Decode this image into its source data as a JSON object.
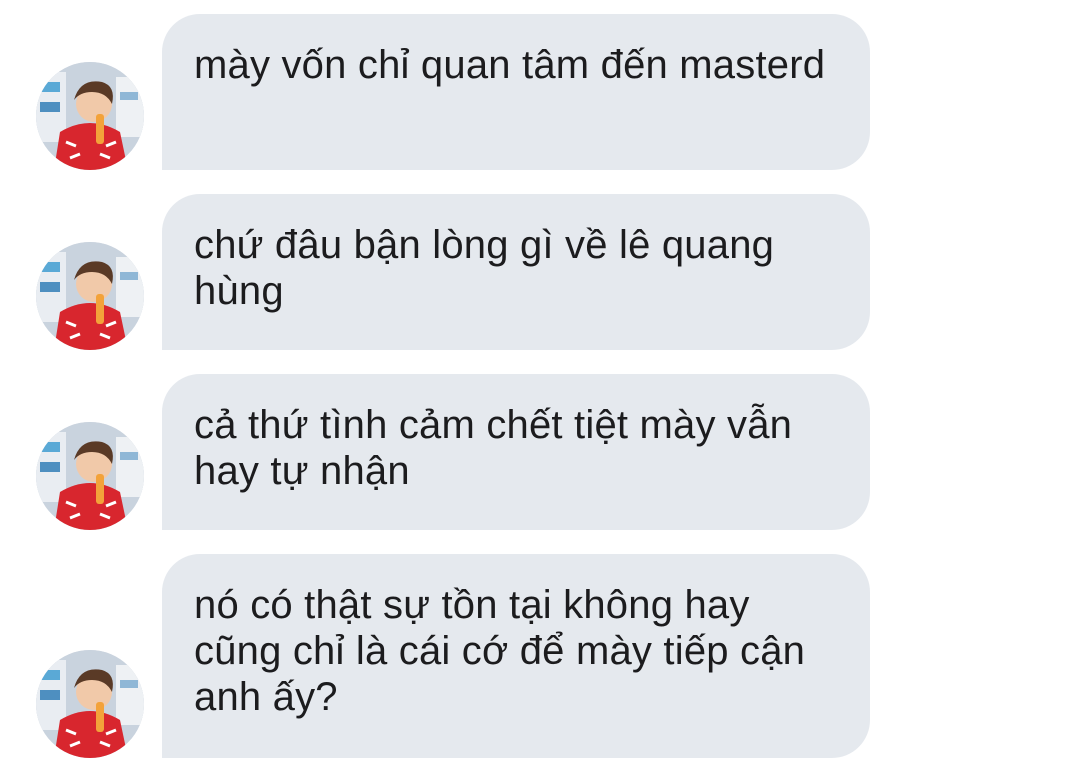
{
  "conversation": {
    "messages": [
      {
        "text": "mày vốn chỉ quan tâm đến masterd"
      },
      {
        "text": "chứ đâu bận lòng gì về lê quang hùng"
      },
      {
        "text": "cả thứ tình cảm chết tiệt mày vẫn hay tự nhận"
      },
      {
        "text": "nó có thật sự tồn tại không hay cũng chỉ là cái cớ để mày tiếp cận anh ấy?"
      }
    ]
  }
}
